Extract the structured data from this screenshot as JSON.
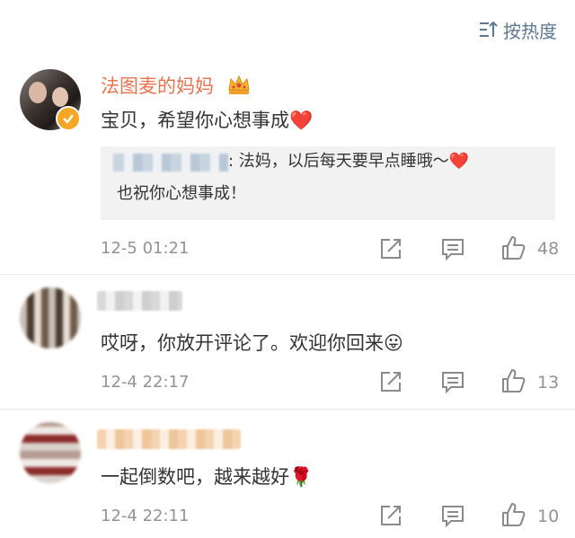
{
  "sort": {
    "label": "按热度"
  },
  "comments": [
    {
      "username": "法图麦的妈妈",
      "text": "宝贝，希望你心想事成❤️",
      "reply": {
        "line1": ": 法妈，以后每天要早点睡哦～❤️",
        "line2": "也祝你心想事成！"
      },
      "time": "12-5 01:21",
      "likes": "48"
    },
    {
      "text": "哎呀，你放开评论了。欢迎你回来😛",
      "time": "12-4 22:17",
      "likes": "13"
    },
    {
      "text": "一起倒数吧，越来越好🌹",
      "time": "12-4 22:11",
      "likes": "10"
    }
  ],
  "colors": {
    "accent": "#eb7350",
    "link": "#5d7895",
    "meta": "#939393",
    "badge": "#f5a623"
  }
}
